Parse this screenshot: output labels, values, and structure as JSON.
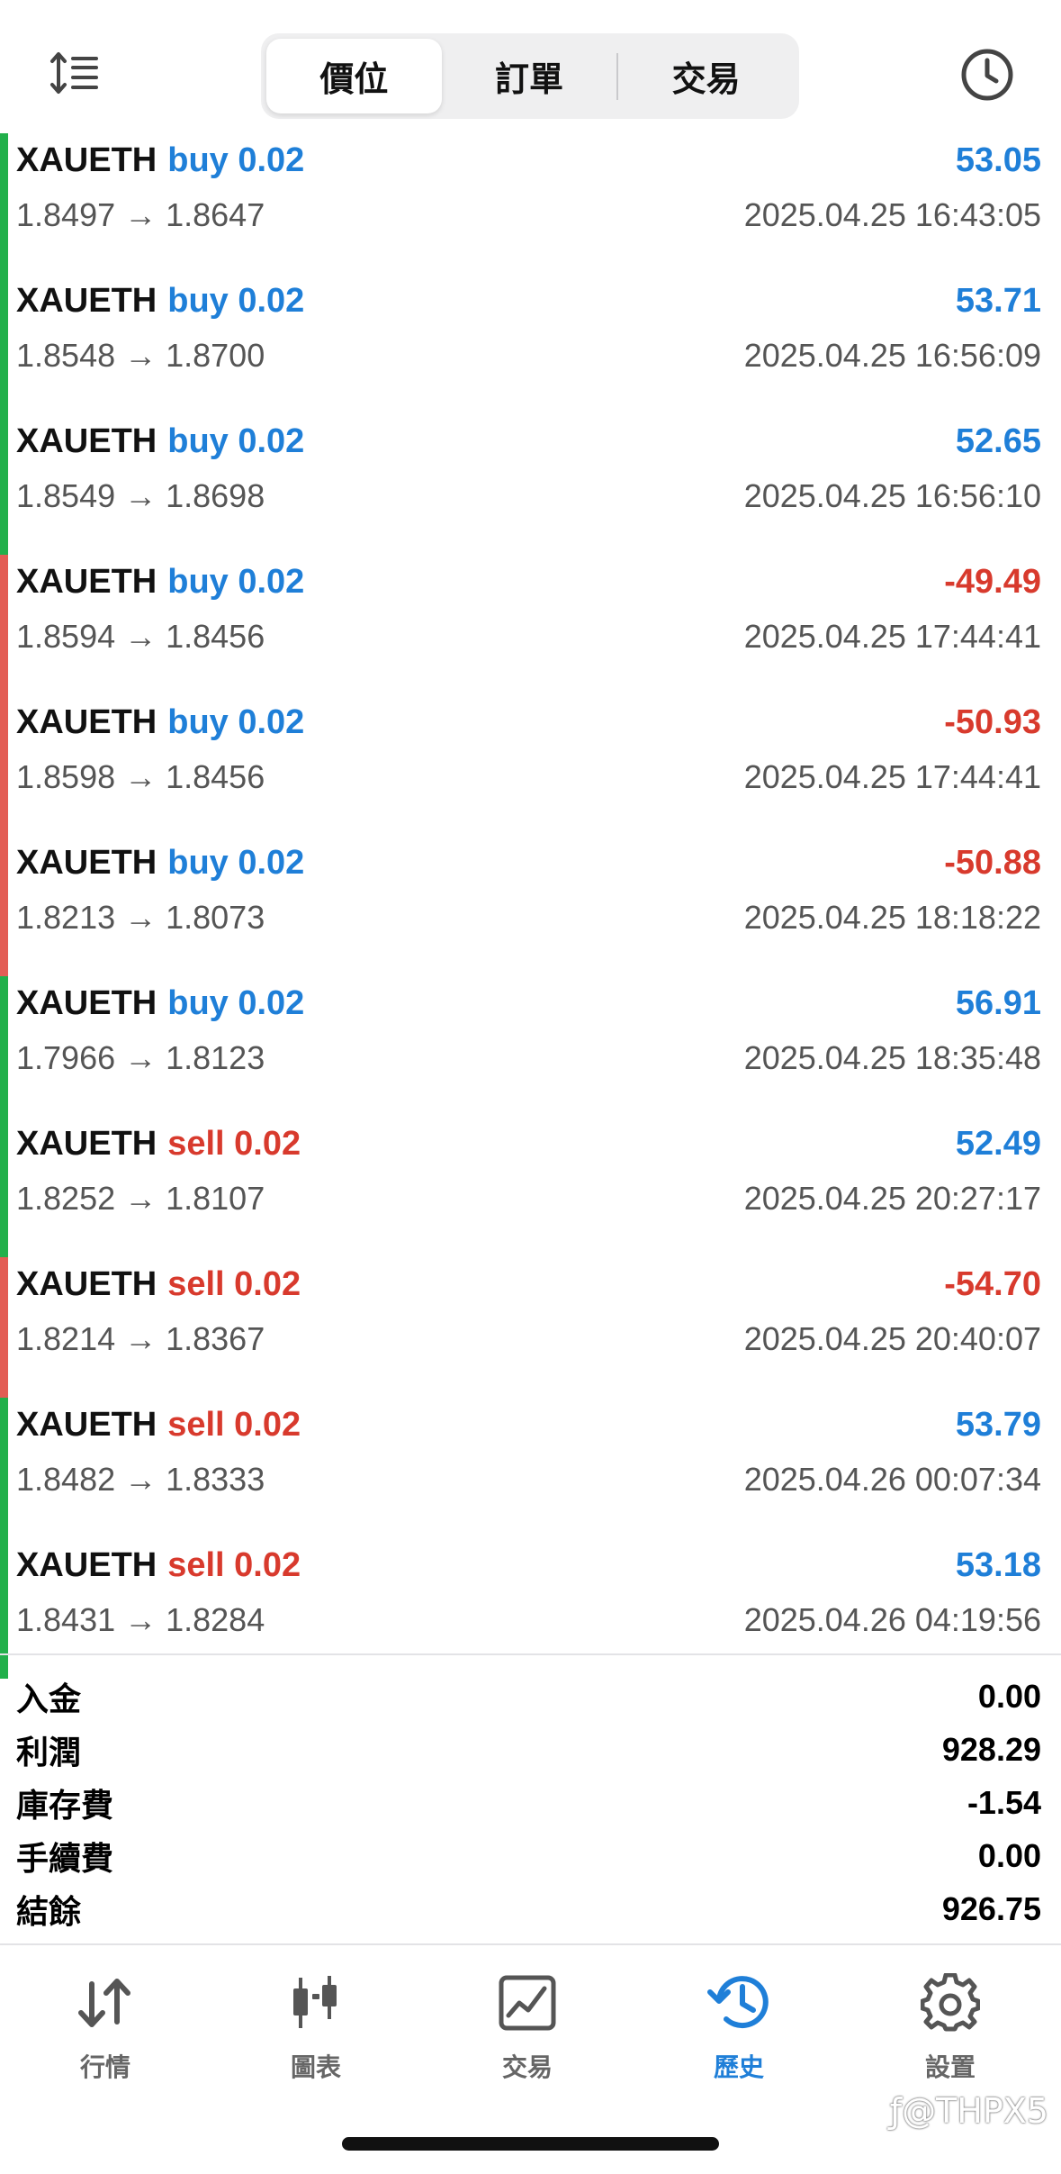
{
  "header": {
    "tabs": [
      {
        "label": "價位",
        "active": true
      },
      {
        "label": "訂單",
        "active": false
      },
      {
        "label": "交易",
        "active": false
      }
    ],
    "sort_icon": "sort-icon",
    "history_icon": "clock-icon"
  },
  "colors": {
    "buy": "#1f7fd8",
    "sell": "#d83a2d",
    "profit_bar": "#22b04b",
    "loss_bar": "#e35d55",
    "accent": "#1f7fd8"
  },
  "trades": [
    {
      "symbol": "XAUETH",
      "side": "buy",
      "volume": "0.02",
      "side_label": "buy 0.02",
      "prices": "1.8497 → 1.8647",
      "time": "2025.04.25 16:43:05",
      "profit": "53.05",
      "result": "win"
    },
    {
      "symbol": "XAUETH",
      "side": "buy",
      "volume": "0.02",
      "side_label": "buy 0.02",
      "prices": "1.8548 → 1.8700",
      "time": "2025.04.25 16:56:09",
      "profit": "53.71",
      "result": "win"
    },
    {
      "symbol": "XAUETH",
      "side": "buy",
      "volume": "0.02",
      "side_label": "buy 0.02",
      "prices": "1.8549 → 1.8698",
      "time": "2025.04.25 16:56:10",
      "profit": "52.65",
      "result": "win"
    },
    {
      "symbol": "XAUETH",
      "side": "buy",
      "volume": "0.02",
      "side_label": "buy 0.02",
      "prices": "1.8594 → 1.8456",
      "time": "2025.04.25 17:44:41",
      "profit": "-49.49",
      "result": "loss"
    },
    {
      "symbol": "XAUETH",
      "side": "buy",
      "volume": "0.02",
      "side_label": "buy 0.02",
      "prices": "1.8598 → 1.8456",
      "time": "2025.04.25 17:44:41",
      "profit": "-50.93",
      "result": "loss"
    },
    {
      "symbol": "XAUETH",
      "side": "buy",
      "volume": "0.02",
      "side_label": "buy 0.02",
      "prices": "1.8213 → 1.8073",
      "time": "2025.04.25 18:18:22",
      "profit": "-50.88",
      "result": "loss"
    },
    {
      "symbol": "XAUETH",
      "side": "buy",
      "volume": "0.02",
      "side_label": "buy 0.02",
      "prices": "1.7966 → 1.8123",
      "time": "2025.04.25 18:35:48",
      "profit": "56.91",
      "result": "win"
    },
    {
      "symbol": "XAUETH",
      "side": "sell",
      "volume": "0.02",
      "side_label": "sell 0.02",
      "prices": "1.8252 → 1.8107",
      "time": "2025.04.25 20:27:17",
      "profit": "52.49",
      "result": "win"
    },
    {
      "symbol": "XAUETH",
      "side": "sell",
      "volume": "0.02",
      "side_label": "sell 0.02",
      "prices": "1.8214 → 1.8367",
      "time": "2025.04.25 20:40:07",
      "profit": "-54.70",
      "result": "loss"
    },
    {
      "symbol": "XAUETH",
      "side": "sell",
      "volume": "0.02",
      "side_label": "sell 0.02",
      "prices": "1.8482 → 1.8333",
      "time": "2025.04.26 00:07:34",
      "profit": "53.79",
      "result": "win"
    },
    {
      "symbol": "XAUETH",
      "side": "sell",
      "volume": "0.02",
      "side_label": "sell 0.02",
      "prices": "1.8431 → 1.8284",
      "time": "2025.04.26 04:19:56",
      "profit": "53.18",
      "result": "win"
    }
  ],
  "summary": [
    {
      "label": "入金",
      "value": "0.00"
    },
    {
      "label": "利潤",
      "value": "928.29"
    },
    {
      "label": "庫存費",
      "value": "-1.54"
    },
    {
      "label": "手續費",
      "value": "0.00"
    },
    {
      "label": "結餘",
      "value": "926.75"
    }
  ],
  "tabbar": [
    {
      "label": "行情",
      "icon": "quotes-arrows-icon",
      "active": false
    },
    {
      "label": "圖表",
      "icon": "candlestick-chart-icon",
      "active": false
    },
    {
      "label": "交易",
      "icon": "trade-chart-icon",
      "active": false
    },
    {
      "label": "歷史",
      "icon": "history-clock-icon",
      "active": true
    },
    {
      "label": "設置",
      "icon": "gear-icon",
      "active": false
    }
  ],
  "watermark": "ƒ@THPX5"
}
